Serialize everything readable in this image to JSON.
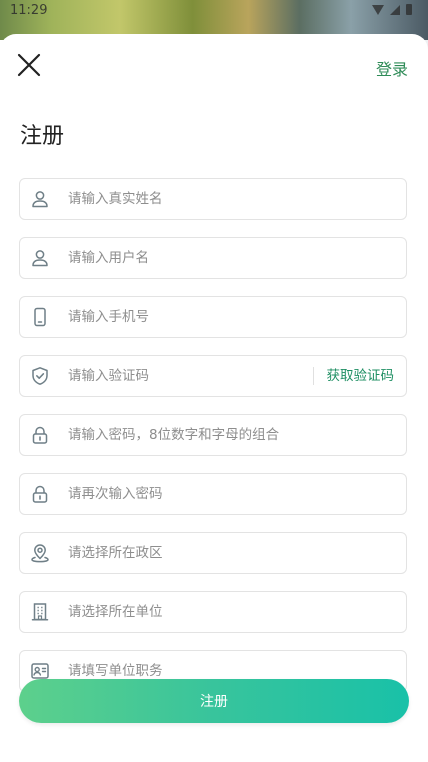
{
  "status": {
    "time": "11:29"
  },
  "header": {
    "login_label": "登录",
    "title": "注册"
  },
  "form": {
    "real_name": {
      "placeholder": "请输入真实姓名",
      "icon": "user-icon"
    },
    "username": {
      "placeholder": "请输入用户名",
      "icon": "user-icon"
    },
    "phone": {
      "placeholder": "请输入手机号",
      "icon": "phone-icon"
    },
    "code": {
      "placeholder": "请输入验证码",
      "icon": "shield-check-icon",
      "button_label": "获取验证码"
    },
    "password": {
      "placeholder": "请输入密码，8位数字和字母的组合",
      "icon": "lock-icon"
    },
    "password_confirm": {
      "placeholder": "请再次输入密码",
      "icon": "lock-icon"
    },
    "district": {
      "placeholder": "请选择所在政区",
      "icon": "location-pin-icon"
    },
    "unit": {
      "placeholder": "请选择所在单位",
      "icon": "building-icon"
    },
    "position": {
      "placeholder": "请填写单位职务",
      "icon": "id-card-icon"
    },
    "submit_label": "注册"
  },
  "colors": {
    "accent": "#1f8f63",
    "button_start": "#5dd08c",
    "button_end": "#19c1a8",
    "icon": "#6f7f87"
  }
}
